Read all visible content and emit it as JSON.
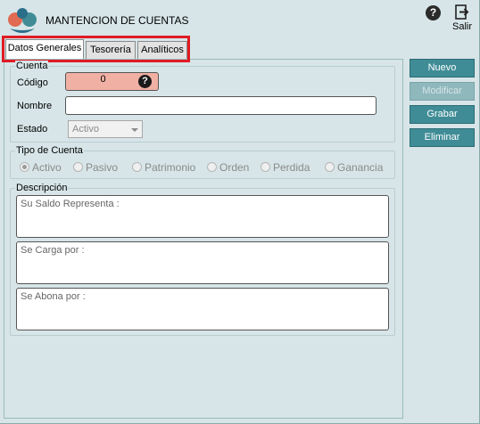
{
  "window": {
    "title": "MANTENCION DE CUENTAS"
  },
  "header": {
    "help_glyph": "?",
    "exit_label": "Salir"
  },
  "tabs": [
    {
      "label": "Datos Generales",
      "active": true
    },
    {
      "label": "Tesorería",
      "active": false
    },
    {
      "label": "Analíticos",
      "active": false
    }
  ],
  "cuenta": {
    "legend": "Cuenta",
    "codigo_label": "Código",
    "codigo_value": "0",
    "codigo_help": "?",
    "nombre_label": "Nombre",
    "nombre_value": "",
    "estado_label": "Estado",
    "estado_value": "Activo"
  },
  "tipo": {
    "legend": "Tipo de Cuenta",
    "options": [
      "Activo",
      "Pasivo",
      "Patrimonio",
      "Orden",
      "Perdida",
      "Ganancia"
    ],
    "selected": "Activo"
  },
  "descripcion": {
    "legend": "Descripción",
    "saldo_label": "Su Saldo Representa :",
    "carga_label": "Se Carga por :",
    "abona_label": "Se Abona por :"
  },
  "actions": {
    "nuevo": "Nuevo",
    "modificar": "Modificar",
    "grabar": "Grabar",
    "eliminar": "Eliminar"
  },
  "colors": {
    "background": "#d7e5e8",
    "button": "#3f8c96",
    "button_disabled": "#8fb8bd",
    "code_field": "#f1b0a4",
    "highlight": "#e01b24"
  }
}
